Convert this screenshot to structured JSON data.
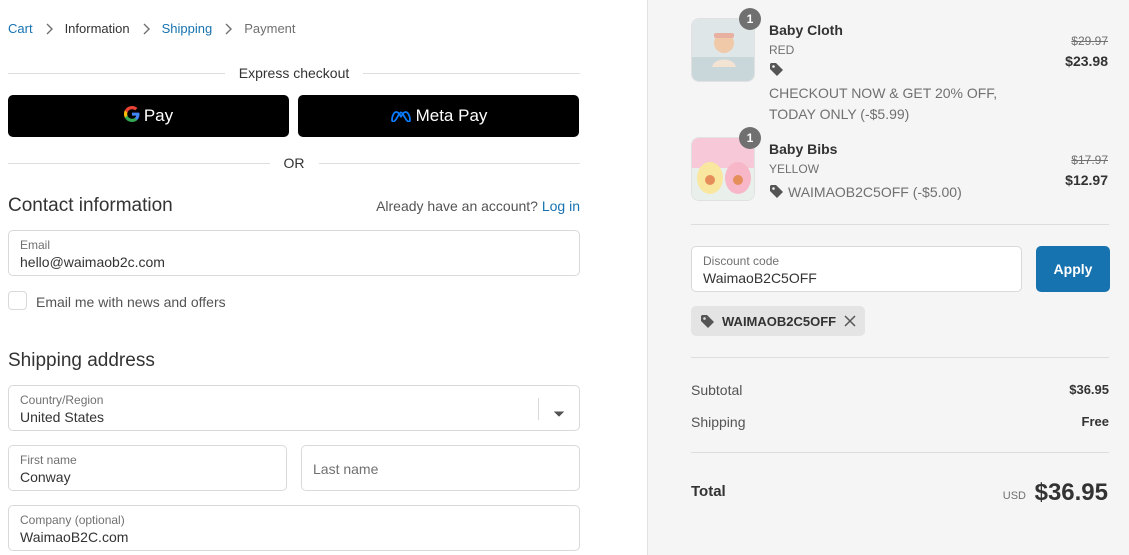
{
  "breadcrumb": {
    "items": [
      "Cart",
      "Information",
      "Shipping",
      "Payment"
    ]
  },
  "express": {
    "title": "Express checkout",
    "gpay_label": "Pay",
    "metapay_label": "Meta Pay",
    "or_label": "OR"
  },
  "contact": {
    "title": "Contact information",
    "account_prompt": "Already have an account?",
    "login_label": "Log in",
    "email_label": "Email",
    "email_value": "hello@waimaob2c.com",
    "newsletter_label": "Email me with news and offers"
  },
  "shipping": {
    "title": "Shipping address",
    "country_label": "Country/Region",
    "country_value": "United States",
    "first_name_label": "First name",
    "first_name_value": "Conway",
    "last_name_placeholder": "Last name",
    "company_label": "Company (optional)",
    "company_value": "WaimaoB2C.com"
  },
  "cart": {
    "items": [
      {
        "qty": "1",
        "name": "Baby Cloth",
        "variant": "RED",
        "discount": "CHECKOUT NOW & GET 20% OFF, TODAY ONLY (-$5.99)",
        "price_old": "$29.97",
        "price_new": "$23.98"
      },
      {
        "qty": "1",
        "name": "Baby Bibs",
        "variant": "YELLOW",
        "discount": "WAIMAOB2C5OFF (-$5.00)",
        "price_old": "$17.97",
        "price_new": "$12.97"
      }
    ]
  },
  "discount": {
    "label": "Discount code",
    "value": "WaimaoB2C5OFF",
    "apply_label": "Apply",
    "applied_tag": "WAIMAOB2C5OFF"
  },
  "summary": {
    "subtotal_label": "Subtotal",
    "subtotal_value": "$36.95",
    "shipping_label": "Shipping",
    "shipping_value": "Free",
    "total_label": "Total",
    "currency": "USD",
    "total_value": "$36.95"
  },
  "colors": {
    "link": "#1773b0",
    "button_dark": "#000000",
    "apply_button": "#1773b0",
    "sidebar_bg": "#f5f5f5"
  }
}
